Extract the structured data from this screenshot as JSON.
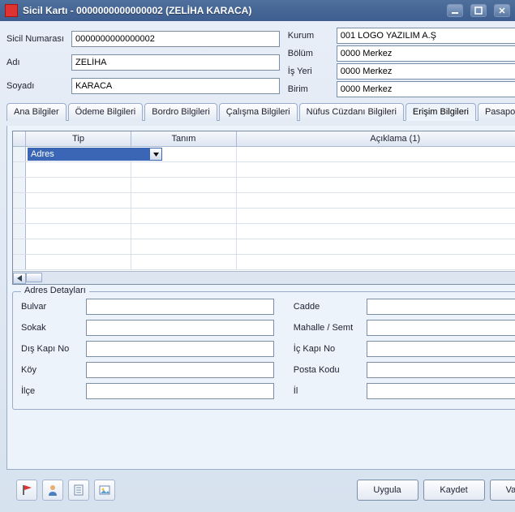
{
  "window": {
    "title": "Sicil Kartı - 0000000000000002 (ZELİHA KARACA)"
  },
  "top": {
    "left": {
      "sicil_label": "Sicil Numarası",
      "sicil_value": "0000000000000002",
      "adi_label": "Adı",
      "adi_value": "ZELİHA",
      "soyadi_label": "Soyadı",
      "soyadi_value": "KARACA"
    },
    "right": {
      "kurum_label": "Kurum",
      "kurum_value": "001 LOGO YAZILIM A.Ş",
      "bolum_label": "Bölüm",
      "bolum_value": "0000 Merkez",
      "isyeri_label": "İş Yeri",
      "isyeri_value": "0000 Merkez",
      "birim_label": "Birim",
      "birim_value": "0000 Merkez"
    }
  },
  "tabs": [
    "Ana Bilgiler",
    "Ödeme Bilgileri",
    "Bordro Bilgileri",
    "Çalışma Bilgileri",
    "Nüfus Cüzdanı Bilgileri",
    "Erişim Bilgileri",
    "Pasaport Bilgileri"
  ],
  "active_tab_index": 5,
  "grid": {
    "headers": {
      "c1": "Tip",
      "c2": "Tanım",
      "c3": "Açıklama (1)"
    },
    "row1_tip": "Adres"
  },
  "fieldset": {
    "legend": "Adres Detayları",
    "left": {
      "bulvar": "Bulvar",
      "sokak": "Sokak",
      "dis_kapi": "Dış Kapı No",
      "koy": "Köy",
      "ilce": "İlçe"
    },
    "right": {
      "cadde": "Cadde",
      "mahalle": "Mahalle / Semt",
      "ic_kapi": "İç Kapı No",
      "posta": "Posta Kodu",
      "il": "İl"
    }
  },
  "buttons": {
    "uygula": "Uygula",
    "kaydet": "Kaydet",
    "vazgec": "Vazgeç"
  }
}
